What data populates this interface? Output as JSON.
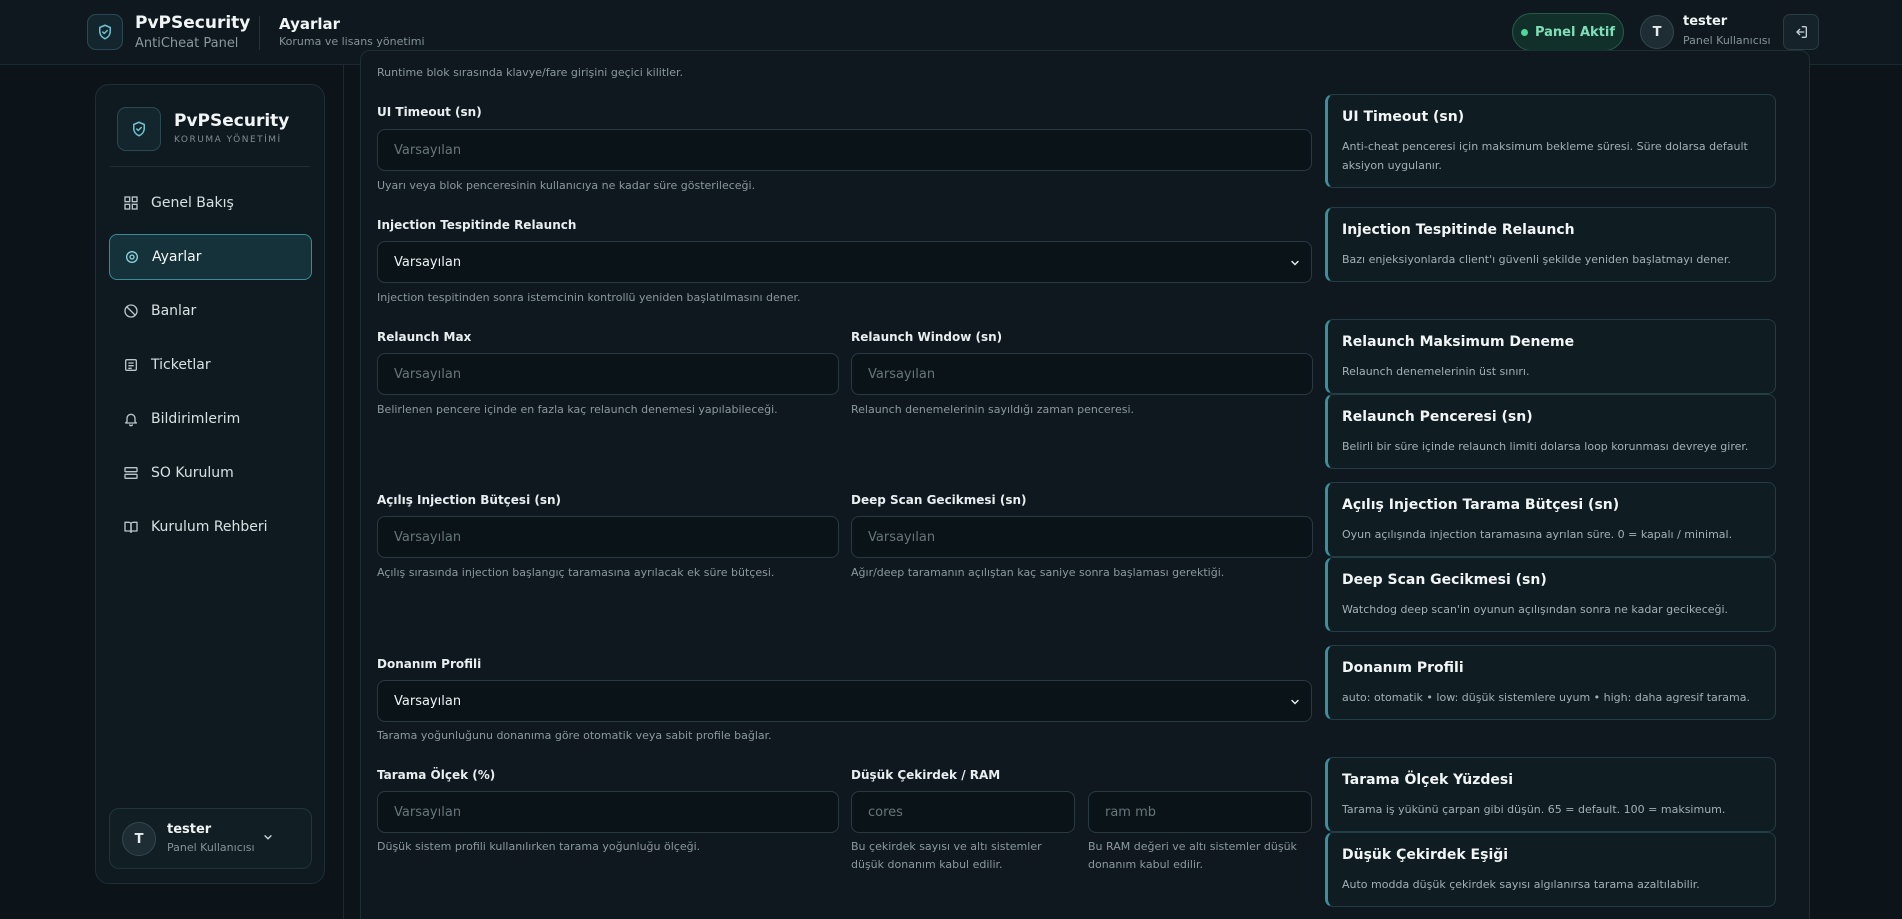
{
  "header": {
    "brand": "PvPSecurity",
    "brand_sub": "AntiCheat Panel",
    "page_title": "Ayarlar",
    "page_subtitle": "Koruma ve lisans yönetimi",
    "status": "Panel Aktif",
    "user_initial": "T",
    "user_name": "tester",
    "user_role": "Panel Kullanıcısı",
    "icons": {
      "logo": "shield-check-icon",
      "logout": "logout-icon"
    },
    "colors": {
      "accent": "#3c8f9e",
      "status": "#4fd69a"
    }
  },
  "sidebar": {
    "brand": "PvPSecurity",
    "tagline": "KORUMA YÖNETİMİ",
    "items": [
      {
        "label": "Genel Bakış",
        "icon": "dashboard-grid-icon",
        "active": false
      },
      {
        "label": "Ayarlar",
        "icon": "settings-icon",
        "active": true
      },
      {
        "label": "Banlar",
        "icon": "ban-icon",
        "active": false
      },
      {
        "label": "Ticketlar",
        "icon": "ticket-icon",
        "active": false
      },
      {
        "label": "Bildirimlerim",
        "icon": "bell-icon",
        "active": false
      },
      {
        "label": "SO Kurulum",
        "icon": "server-icon",
        "active": false
      },
      {
        "label": "Kurulum Rehberi",
        "icon": "book-icon",
        "active": false
      }
    ],
    "user": {
      "initial": "T",
      "name": "tester",
      "role": "Panel Kullanıcısı"
    }
  },
  "form": {
    "top_hint": "Runtime blok sırasında klavye/fare girişini geçici kilitler.",
    "ui_timeout": {
      "label": "UI Timeout (sn)",
      "placeholder": "Varsayılan",
      "hint": "Uyarı veya blok penceresinin kullanıcıya ne kadar süre gösterileceği."
    },
    "relaunch_injection": {
      "label": "Injection Tespitinde Relaunch",
      "value": "Varsayılan",
      "hint": "Injection tespitinden sonra istemcinin kontrollü yeniden başlatılmasını dener."
    },
    "relaunch_max": {
      "label": "Relaunch Max",
      "placeholder": "Varsayılan",
      "hint": "Belirlenen pencere içinde en fazla kaç relaunch denemesi yapılabileceği."
    },
    "relaunch_window": {
      "label": "Relaunch Window (sn)",
      "placeholder": "Varsayılan",
      "hint": "Relaunch denemelerinin sayıldığı zaman penceresi."
    },
    "startup_budget": {
      "label": "Açılış Injection Bütçesi (sn)",
      "placeholder": "Varsayılan",
      "hint": "Açılış sırasında injection başlangıç taramasına ayrılacak ek süre bütçesi."
    },
    "deep_scan_delay": {
      "label": "Deep Scan Gecikmesi (sn)",
      "placeholder": "Varsayılan",
      "hint": "Ağır/deep taramanın açılıştan kaç saniye sonra başlaması gerektiği."
    },
    "hardware_profile": {
      "label": "Donanım Profili",
      "value": "Varsayılan",
      "hint": "Tarama yoğunluğunu donanıma göre otomatik veya sabit profile bağlar."
    },
    "scan_scale": {
      "label": "Tarama Ölçek (%)",
      "placeholder": "Varsayılan",
      "hint": "Düşük sistem profili kullanılırken tarama yoğunluğu ölçeği."
    },
    "low_core_ram": {
      "label": "Düşük Çekirdek / RAM",
      "cores_placeholder": "cores",
      "ram_placeholder": "ram mb",
      "cores_hint": "Bu çekirdek sayısı ve altı sistemler düşük donanım kabul edilir.",
      "ram_hint": "Bu RAM değeri ve altı sistemler düşük donanım kabul edilir."
    }
  },
  "info_cards": [
    {
      "title": "UI Timeout (sn)",
      "desc": "Anti-cheat penceresi için maksimum bekleme süresi. Süre dolarsa default aksiyon uygulanır."
    },
    {
      "title": "Injection Tespitinde Relaunch",
      "desc": "Bazı enjeksiyonlarda client'ı güvenli şekilde yeniden başlatmayı dener."
    },
    {
      "title": "Relaunch Maksimum Deneme",
      "desc": "Relaunch denemelerinin üst sınırı."
    },
    {
      "title": "Relaunch Penceresi (sn)",
      "desc": "Belirli bir süre içinde relaunch limiti dolarsa loop korunması devreye girer."
    },
    {
      "title": "Açılış Injection Tarama Bütçesi (sn)",
      "desc": "Oyun açılışında injection taramasına ayrılan süre. 0 = kapalı / minimal."
    },
    {
      "title": "Deep Scan Gecikmesi (sn)",
      "desc": "Watchdog deep scan'in oyunun açılışından sonra ne kadar gecikeceği."
    },
    {
      "title": "Donanım Profili",
      "desc": "auto: otomatik • low: düşük sistemlere uyum • high: daha agresif tarama."
    },
    {
      "title": "Tarama Ölçek Yüzdesi",
      "desc": "Tarama iş yükünü çarpan gibi düşün. 65 = default. 100 = maksimum."
    },
    {
      "title": "Düşük Çekirdek Eşiği",
      "desc": "Auto modda düşük çekirdek sayısı algılanırsa tarama azaltılabilir."
    }
  ]
}
